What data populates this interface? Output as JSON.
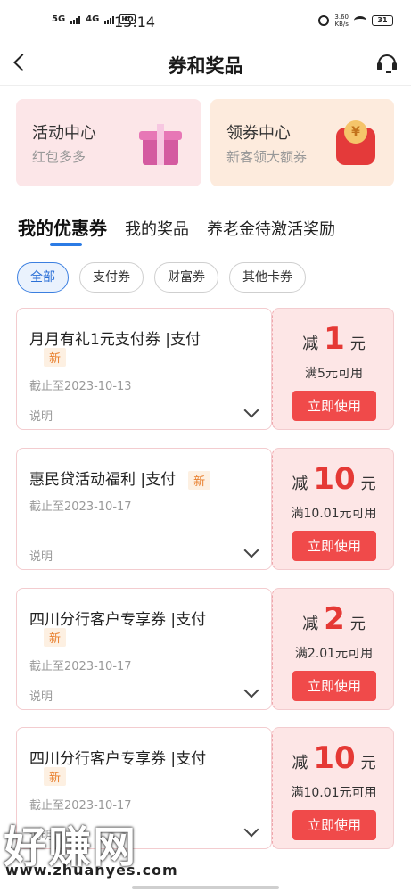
{
  "status_bar": {
    "network_1": "5G",
    "network_2": "4G",
    "hd": "HD",
    "time": "15:14",
    "speed": "3.60",
    "speed_unit": "KB/s",
    "battery": "31"
  },
  "nav": {
    "title": "券和奖品"
  },
  "banners": [
    {
      "title": "活动中心",
      "subtitle": "红包多多"
    },
    {
      "title": "领券中心",
      "subtitle": "新客领大额券",
      "icon_glyph": "¥"
    }
  ],
  "tabs": [
    {
      "label": "我的优惠券",
      "active": true
    },
    {
      "label": "我的奖品",
      "active": false
    },
    {
      "label": "养老金待激活奖励",
      "active": false
    }
  ],
  "chips": [
    {
      "label": "全部",
      "active": true
    },
    {
      "label": "支付券",
      "active": false
    },
    {
      "label": "财富券",
      "active": false
    },
    {
      "label": "其他卡券",
      "active": false
    }
  ],
  "coupons": [
    {
      "title": "月月有礼1元支付券 |支付",
      "badge": "新",
      "date": "截止至2023-10-13",
      "desc": "说明",
      "prefix": "减",
      "amount": "1",
      "suffix": "元",
      "condition": "满5元可用",
      "button": "立即使用"
    },
    {
      "title": "惠民贷活动福利 |支付",
      "badge": "新",
      "date": "截止至2023-10-17",
      "desc": "说明",
      "prefix": "减",
      "amount": "10",
      "suffix": "元",
      "condition": "满10.01元可用",
      "button": "立即使用"
    },
    {
      "title": "四川分行客户专享券 |支付",
      "badge": "新",
      "date": "截止至2023-10-17",
      "desc": "说明",
      "prefix": "减",
      "amount": "2",
      "suffix": "元",
      "condition": "满2.01元可用",
      "button": "立即使用"
    },
    {
      "title": "四川分行客户专享券 |支付",
      "badge": "新",
      "date": "截止至2023-10-17",
      "desc": "说明",
      "prefix": "减",
      "amount": "10",
      "suffix": "元",
      "condition": "满10.01元可用",
      "button": "立即使用"
    }
  ],
  "watermark": {
    "text": "好赚网",
    "url": "www.zhuanyes.com"
  },
  "colors": {
    "accent_blue": "#2b7be5",
    "coupon_red": "#e53935",
    "button_red": "#f04a4a",
    "badge_orange": "#e87e2c"
  }
}
